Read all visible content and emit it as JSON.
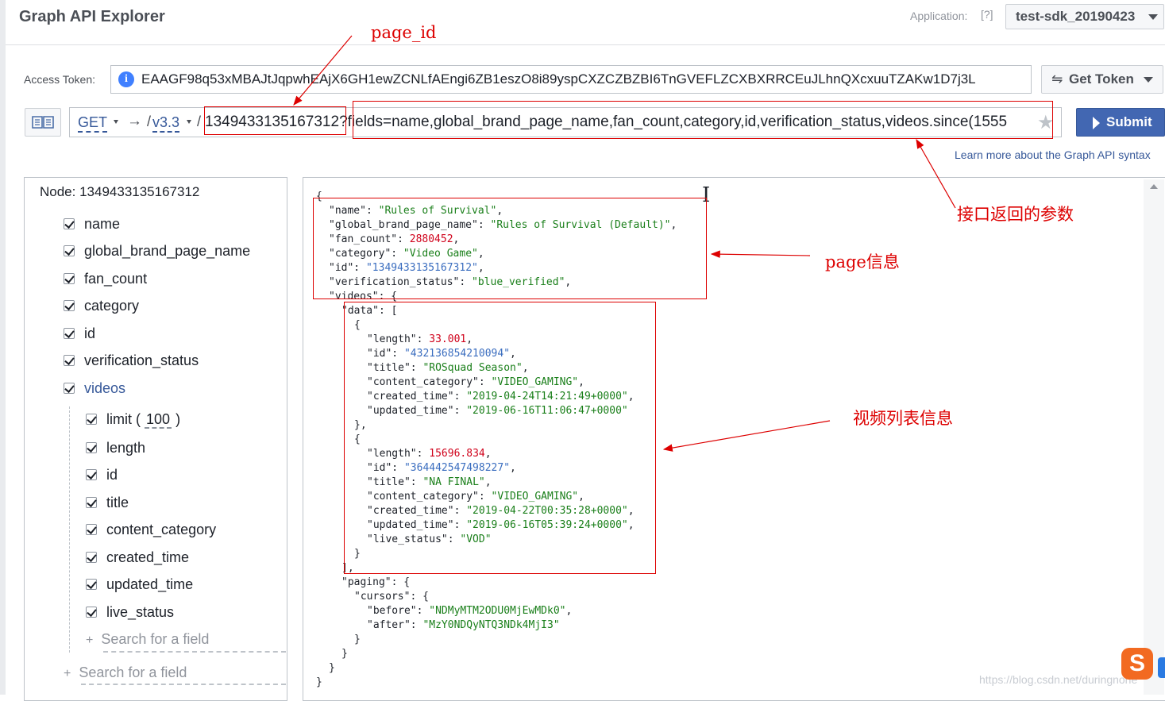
{
  "header": {
    "title": "Graph API Explorer",
    "application_label": "Application:",
    "help": "[?]",
    "application_value": "test-sdk_20190423"
  },
  "token": {
    "label": "Access Token:",
    "info_icon": "i",
    "value": "EAAGF98q53xMBAJtJqpwhEAjX6GH1ewZCNLfAEngi6ZB1eszO8i89yspCXZCZBZBI6TnGVEFLZCXBXRRCEuJLhnQXcxuuTZAKw1D7j3L",
    "get_token_icon": "⇋",
    "get_token_label": "Get Token"
  },
  "query": {
    "method": "GET",
    "arrow": "→",
    "slash1": "/",
    "version": "v3.3",
    "slash2": "/",
    "path": "1349433135167312?fields=name,global_brand_page_name,fan_count,category,id,verification_status,videos.since(1555",
    "star": "★",
    "submit_label": "Submit",
    "learn_more": "Learn more about the Graph API syntax"
  },
  "left_panel": {
    "node_label": "Node:  1349433135167312",
    "fields": [
      {
        "label": "name"
      },
      {
        "label": "global_brand_page_name"
      },
      {
        "label": "fan_count"
      },
      {
        "label": "category"
      },
      {
        "label": "id"
      },
      {
        "label": "verification_status"
      },
      {
        "label": "videos"
      }
    ],
    "sub_fields": {
      "limit_label": "limit",
      "limit_open": "(",
      "limit_value": "100",
      "limit_close": ")",
      "items": [
        {
          "label": "length"
        },
        {
          "label": "id"
        },
        {
          "label": "title"
        },
        {
          "label": "content_category"
        },
        {
          "label": "created_time"
        },
        {
          "label": "updated_time"
        },
        {
          "label": "live_status"
        }
      ],
      "search_placeholder": "Search for a field"
    },
    "search_placeholder": "Search for a field",
    "plus": "+"
  },
  "result": {
    "lines": [
      {
        "text": "{",
        "indent": 0
      },
      {
        "key": "name",
        "val": "Rules of Survival",
        "type": "s",
        "comma": true,
        "indent": 1
      },
      {
        "key": "global_brand_page_name",
        "val": "Rules of Survival (Default)",
        "type": "s",
        "comma": true,
        "indent": 1
      },
      {
        "key": "fan_count",
        "val": "2880452",
        "type": "n",
        "comma": true,
        "indent": 1
      },
      {
        "key": "category",
        "val": "Video Game",
        "type": "s",
        "comma": true,
        "indent": 1
      },
      {
        "key": "id",
        "val": "1349433135167312",
        "type": "i",
        "comma": true,
        "indent": 1
      },
      {
        "key": "verification_status",
        "val": "blue_verified",
        "type": "s",
        "comma": true,
        "indent": 1
      },
      {
        "key": "videos",
        "raw": "{",
        "indent": 1
      },
      {
        "key": "data",
        "raw": "[",
        "indent": 2
      },
      {
        "text": "{",
        "indent": 3
      },
      {
        "key": "length",
        "val": "33.001",
        "type": "n",
        "comma": true,
        "indent": 4
      },
      {
        "key": "id",
        "val": "432136854210094",
        "type": "i",
        "comma": true,
        "indent": 4
      },
      {
        "key": "title",
        "val": "ROSquad Season",
        "type": "s",
        "comma": true,
        "indent": 4
      },
      {
        "key": "content_category",
        "val": "VIDEO_GAMING",
        "type": "s",
        "comma": true,
        "indent": 4
      },
      {
        "key": "created_time",
        "val": "2019-04-24T14:21:49+0000",
        "type": "s",
        "comma": true,
        "indent": 4
      },
      {
        "key": "updated_time",
        "val": "2019-06-16T11:06:47+0000",
        "type": "s",
        "comma": false,
        "indent": 4
      },
      {
        "text": "},",
        "indent": 3
      },
      {
        "text": "{",
        "indent": 3
      },
      {
        "key": "length",
        "val": "15696.834",
        "type": "n",
        "comma": true,
        "indent": 4
      },
      {
        "key": "id",
        "val": "364442547498227",
        "type": "i",
        "comma": true,
        "indent": 4
      },
      {
        "key": "title",
        "val": "NA FINAL",
        "type": "s",
        "comma": true,
        "indent": 4
      },
      {
        "key": "content_category",
        "val": "VIDEO_GAMING",
        "type": "s",
        "comma": true,
        "indent": 4
      },
      {
        "key": "created_time",
        "val": "2019-04-22T00:35:28+0000",
        "type": "s",
        "comma": true,
        "indent": 4
      },
      {
        "key": "updated_time",
        "val": "2019-06-16T05:39:24+0000",
        "type": "s",
        "comma": true,
        "indent": 4
      },
      {
        "key": "live_status",
        "val": "VOD",
        "type": "s",
        "comma": false,
        "indent": 4
      },
      {
        "text": "}",
        "indent": 3
      },
      {
        "text": "],",
        "indent": 2
      },
      {
        "key": "paging",
        "raw": "{",
        "indent": 2
      },
      {
        "key": "cursors",
        "raw": "{",
        "indent": 3
      },
      {
        "key": "before",
        "val": "NDMyMTM2ODU0MjEwMDk0",
        "type": "s",
        "comma": true,
        "indent": 4
      },
      {
        "key": "after",
        "val": "MzY0NDQyNTQ3NDk4MjI3",
        "type": "s",
        "comma": false,
        "indent": 4
      },
      {
        "text": "}",
        "indent": 3
      },
      {
        "text": "}",
        "indent": 2
      },
      {
        "text": "}",
        "indent": 1
      },
      {
        "text": "}",
        "indent": 0
      }
    ]
  },
  "annotations": {
    "page_id": "page_id",
    "returned_params": "接口返回的参数",
    "page_info": "page信息",
    "video_list_info": "视频列表信息",
    "annotation_color": "#dd0000"
  },
  "watermark": "https://blog.csdn.net/duringnone",
  "ime_icon": "S",
  "colors": {
    "accent": "#4267b2",
    "link": "#365899",
    "string": "#1a7f1a",
    "number": "#d0021b",
    "id": "#3a6dbf"
  }
}
